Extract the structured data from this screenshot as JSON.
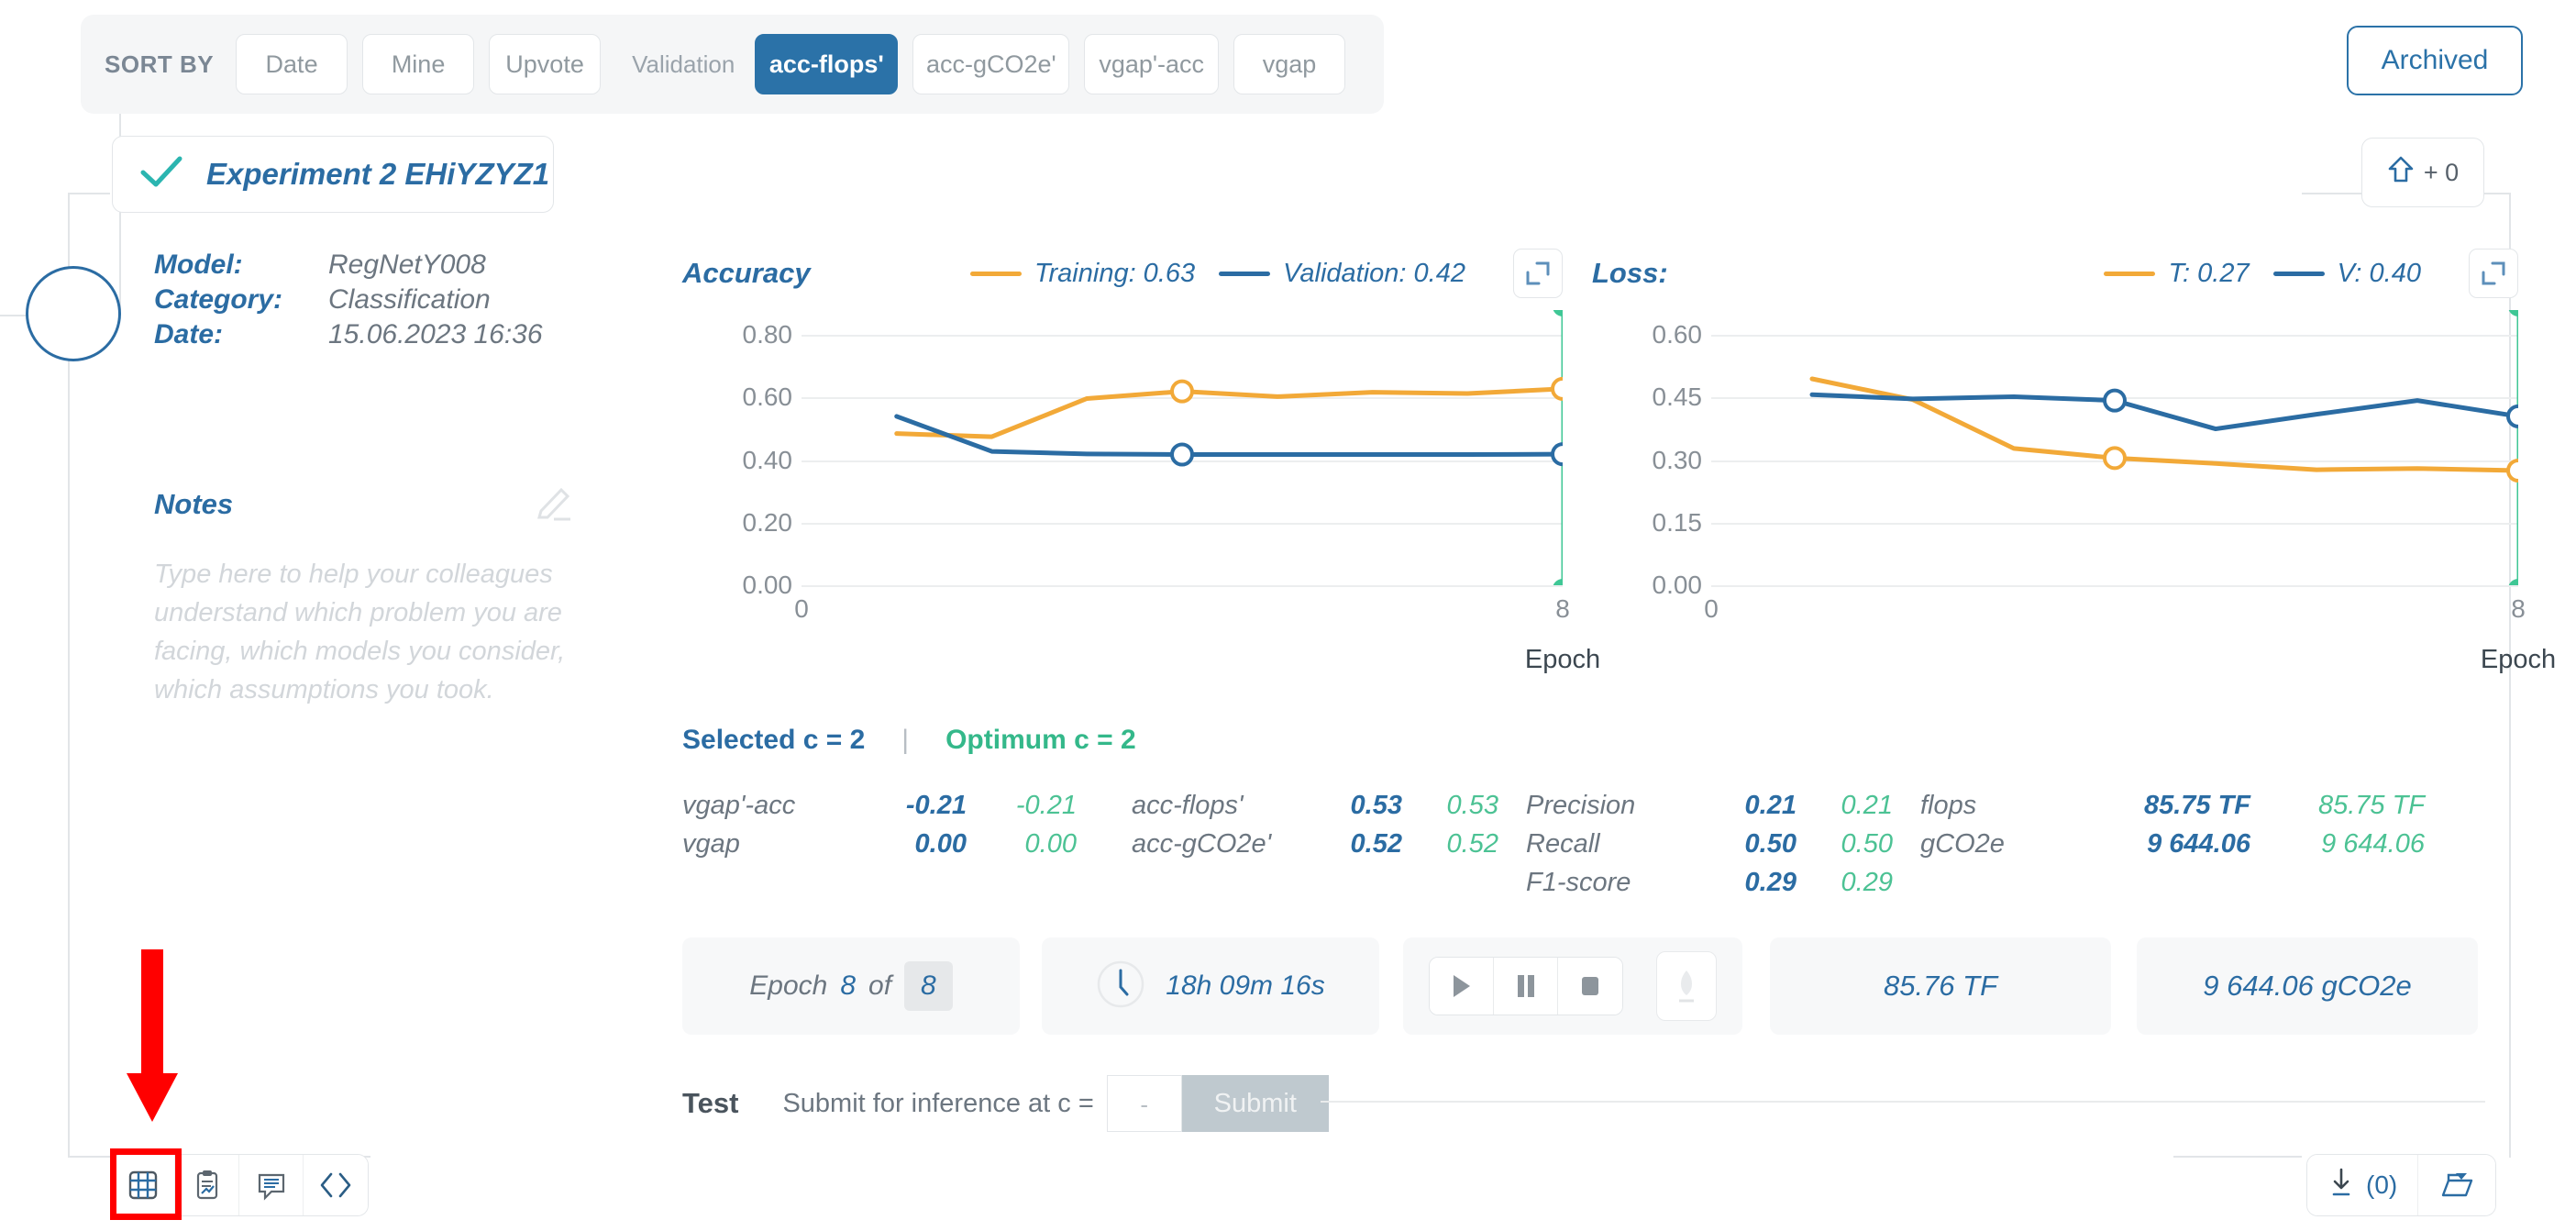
{
  "sortbar": {
    "label": "SORT BY",
    "chips": [
      "Date",
      "Mine",
      "Upvote"
    ],
    "validation_label": "Validation",
    "metric_chips": [
      {
        "label": "acc-flops'",
        "active": true
      },
      {
        "label": "acc-gCO2e'",
        "active": false
      },
      {
        "label": "vgap'-acc",
        "active": false
      },
      {
        "label": "vgap",
        "active": false
      }
    ],
    "archived_label": "Archived"
  },
  "experiment": {
    "title": "Experiment 2  EHiYZYZ1",
    "check_icon": "check-icon",
    "upvote_icon": "upvote-arrow-icon",
    "upvote_label": "+ 0"
  },
  "info": {
    "rows": [
      {
        "key": "Model:",
        "value": "RegNetY008"
      },
      {
        "key": "Category:",
        "value": "Classification"
      },
      {
        "key": "Date:",
        "value": "15.06.2023 16:36"
      }
    ]
  },
  "notes": {
    "title": "Notes",
    "edit_icon": "pencil-icon",
    "placeholder": "Type here to help your colleagues understand which problem you are facing, which models you consider, which assumptions you took."
  },
  "chart_data": [
    {
      "type": "line",
      "title": "Accuracy",
      "xlabel": "Epoch",
      "ylabel": "",
      "xlim": [
        0,
        8
      ],
      "ylim": [
        0.0,
        0.88
      ],
      "xticks": [
        "0",
        "8"
      ],
      "yticks": [
        "0.00",
        "0.20",
        "0.40",
        "0.60",
        "0.80"
      ],
      "grid": true,
      "legend_position": "top-right",
      "legend": [
        {
          "name": "Training: 0.63",
          "color": "#f2a938"
        },
        {
          "name": "Validation: 0.42",
          "color": "#2b6ca3"
        }
      ],
      "marker_epoch": 8,
      "marker_color": "#3fc795",
      "x": [
        1,
        2,
        3,
        4,
        5,
        6,
        7,
        8
      ],
      "series": [
        {
          "name": "Training",
          "color": "#f2a938",
          "final": 0.63,
          "values": [
            0.485,
            0.475,
            0.597,
            0.62,
            0.603,
            0.617,
            0.613,
            0.628
          ],
          "points": [
            {
              "x": 4,
              "y": 0.62
            },
            {
              "x": 8,
              "y": 0.628
            }
          ]
        },
        {
          "name": "Validation",
          "color": "#2b6ca3",
          "final": 0.42,
          "values": [
            0.54,
            0.428,
            0.42,
            0.418,
            0.418,
            0.418,
            0.418,
            0.419
          ],
          "points": [
            {
              "x": 4,
              "y": 0.418
            },
            {
              "x": 8,
              "y": 0.419
            }
          ]
        }
      ],
      "expand_icon": "expand-icon"
    },
    {
      "type": "line",
      "title": "Loss:",
      "xlabel": "Epoch",
      "ylabel": "",
      "xlim": [
        0,
        8
      ],
      "ylim": [
        0.0,
        0.66
      ],
      "xticks": [
        "0",
        "8"
      ],
      "yticks": [
        "0.00",
        "0.15",
        "0.30",
        "0.45",
        "0.60"
      ],
      "grid": true,
      "legend_position": "top-right",
      "legend": [
        {
          "name": "T: 0.27",
          "color": "#f2a938"
        },
        {
          "name": "V: 0.40",
          "color": "#2b6ca3"
        }
      ],
      "marker_epoch": 8,
      "marker_color": "#3fc795",
      "x": [
        1,
        2,
        3,
        4,
        5,
        6,
        7,
        8
      ],
      "series": [
        {
          "name": "T",
          "color": "#f2a938",
          "final": 0.27,
          "values": [
            0.495,
            0.445,
            0.328,
            0.305,
            0.292,
            0.277,
            0.28,
            0.275
          ],
          "points": [
            {
              "x": 4,
              "y": 0.305
            },
            {
              "x": 8,
              "y": 0.275
            }
          ]
        },
        {
          "name": "V",
          "color": "#2b6ca3",
          "final": 0.4,
          "values": [
            0.457,
            0.447,
            0.452,
            0.443,
            0.375,
            0.41,
            0.443,
            0.405
          ],
          "points": [
            {
              "x": 4,
              "y": 0.443
            },
            {
              "x": 8,
              "y": 0.405
            }
          ]
        }
      ],
      "expand_icon": "expand-icon"
    }
  ],
  "selection": {
    "selected": "Selected c = 2",
    "divider": "|",
    "optimum": "Optimum c = 2"
  },
  "metrics": {
    "groups": [
      {
        "rows": [
          {
            "name": "vgap'-acc",
            "blue": "-0.21",
            "green": "-0.21"
          },
          {
            "name": "vgap",
            "blue": "0.00",
            "green": "0.00"
          }
        ]
      },
      {
        "rows": [
          {
            "name": "acc-flops'",
            "blue": "0.53",
            "green": "0.53"
          },
          {
            "name": "acc-gCO2e'",
            "blue": "0.52",
            "green": "0.52"
          }
        ]
      },
      {
        "rows": [
          {
            "name": "Precision",
            "blue": "0.21",
            "green": "0.21"
          },
          {
            "name": "Recall",
            "blue": "0.50",
            "green": "0.50"
          },
          {
            "name": "F1-score",
            "blue": "0.29",
            "green": "0.29"
          }
        ]
      },
      {
        "rows": [
          {
            "name": "flops",
            "blue": "85.75 TF",
            "green": "85.75 TF"
          },
          {
            "name": "gCO2e",
            "blue": "9 644.06",
            "green": "9 644.06"
          }
        ]
      }
    ]
  },
  "controls": {
    "epoch_word": "Epoch",
    "epoch_current": "8",
    "epoch_of": "of",
    "epoch_total": "8",
    "clock_icon": "clock-icon",
    "elapsed": "18h 09m 16s",
    "play_icon": "play-icon",
    "pause_icon": "pause-icon",
    "stop_icon": "stop-icon",
    "leaf_icon": "leaf-icon",
    "flops_stat": "85.76 TF",
    "co2_stat": "9 644.06 gCO2e"
  },
  "test": {
    "label": "Test",
    "sub_label": "Submit for inference at c =",
    "input_value": "-",
    "submit_label": "Submit"
  },
  "bottom_left_icons": [
    {
      "icon": "grid-table-icon",
      "active": true
    },
    {
      "icon": "clipboard-chart-icon",
      "active": false
    },
    {
      "icon": "comment-icon",
      "active": false
    },
    {
      "icon": "code-brackets-icon",
      "active": false
    }
  ],
  "bottom_right": {
    "download_icon": "download-icon",
    "download_count": "(0)",
    "folder_icon": "folder-open-icon"
  },
  "annotation": {
    "arrow_color": "#ff0000",
    "highlight_color": "#ff0000"
  }
}
